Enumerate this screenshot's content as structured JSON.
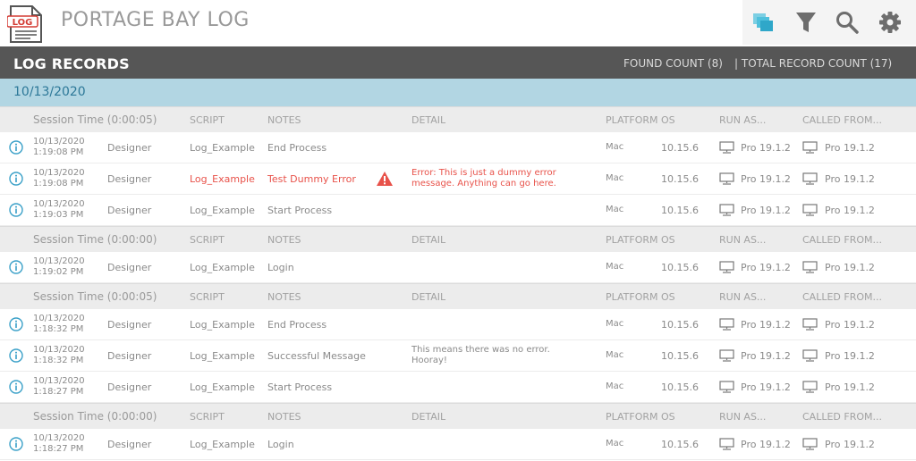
{
  "app": {
    "title": "PORTAGE BAY LOG",
    "logo_text": "LOG"
  },
  "toolbar": {
    "icons": [
      "windows-icon",
      "filter-icon",
      "search-icon",
      "gear-icon"
    ]
  },
  "section": {
    "title": "LOG RECORDS",
    "found_count": "FOUND COUNT (8)",
    "total_count": "|  TOTAL RECORD COUNT (17)"
  },
  "date_group": {
    "date": "10/13/2020"
  },
  "columns": {
    "script": "SCRIPT",
    "notes": "NOTES",
    "detail": "DETAIL",
    "platform": "PLATFORM",
    "os": "OS",
    "run_as": "RUN AS...",
    "called_from": "CALLED FROM..."
  },
  "sessions": [
    {
      "session_time": "Session Time (0:00:05)",
      "records": [
        {
          "date": "10/13/2020",
          "time": "1:19:08 PM",
          "user": "Designer",
          "script": "Log_Example",
          "notes": "End Process",
          "detail1": "",
          "detail2": "",
          "platform": "Mac",
          "os": "10.15.6",
          "run_as": "Pro 19.1.2",
          "called_from": "Pro 19.1.2",
          "error": false
        },
        {
          "date": "10/13/2020",
          "time": "1:19:08 PM",
          "user": "Designer",
          "script": "Log_Example",
          "notes": "Test Dummy Error",
          "detail1": "Error: This is just a dummy error",
          "detail2": "message. Anything can go here.",
          "platform": "Mac",
          "os": "10.15.6",
          "run_as": "Pro 19.1.2",
          "called_from": "Pro 19.1.2",
          "error": true
        },
        {
          "date": "10/13/2020",
          "time": "1:19:03 PM",
          "user": "Designer",
          "script": "Log_Example",
          "notes": "Start Process",
          "detail1": "",
          "detail2": "",
          "platform": "Mac",
          "os": "10.15.6",
          "run_as": "Pro 19.1.2",
          "called_from": "Pro 19.1.2",
          "error": false
        }
      ]
    },
    {
      "session_time": "Session Time (0:00:00)",
      "records": [
        {
          "date": "10/13/2020",
          "time": "1:19:02 PM",
          "user": "Designer",
          "script": "Log_Example",
          "notes": "Login",
          "detail1": "",
          "detail2": "",
          "platform": "Mac",
          "os": "10.15.6",
          "run_as": "Pro 19.1.2",
          "called_from": "Pro 19.1.2",
          "error": false
        }
      ]
    },
    {
      "session_time": "Session Time (0:00:05)",
      "records": [
        {
          "date": "10/13/2020",
          "time": "1:18:32 PM",
          "user": "Designer",
          "script": "Log_Example",
          "notes": "End Process",
          "detail1": "",
          "detail2": "",
          "platform": "Mac",
          "os": "10.15.6",
          "run_as": "Pro 19.1.2",
          "called_from": "Pro 19.1.2",
          "error": false
        },
        {
          "date": "10/13/2020",
          "time": "1:18:32 PM",
          "user": "Designer",
          "script": "Log_Example",
          "notes": "Successful Message",
          "detail1": "This means there was no error.",
          "detail2": "Hooray!",
          "platform": "Mac",
          "os": "10.15.6",
          "run_as": "Pro 19.1.2",
          "called_from": "Pro 19.1.2",
          "error": false
        },
        {
          "date": "10/13/2020",
          "time": "1:18:27 PM",
          "user": "Designer",
          "script": "Log_Example",
          "notes": "Start Process",
          "detail1": "",
          "detail2": "",
          "platform": "Mac",
          "os": "10.15.6",
          "run_as": "Pro 19.1.2",
          "called_from": "Pro 19.1.2",
          "error": false
        }
      ]
    },
    {
      "session_time": "Session Time (0:00:00)",
      "records": [
        {
          "date": "10/13/2020",
          "time": "1:18:27 PM",
          "user": "Designer",
          "script": "Log_Example",
          "notes": "Login",
          "detail1": "",
          "detail2": "",
          "platform": "Mac",
          "os": "10.15.6",
          "run_as": "Pro 19.1.2",
          "called_from": "Pro 19.1.2",
          "error": false
        }
      ]
    }
  ],
  "colors": {
    "header_bar": "#565656",
    "date_bar": "#b2d6e3",
    "info_icon": "#3aa0c8",
    "error": "#e8524a",
    "toolbar_accent": "#3bb7d6"
  }
}
